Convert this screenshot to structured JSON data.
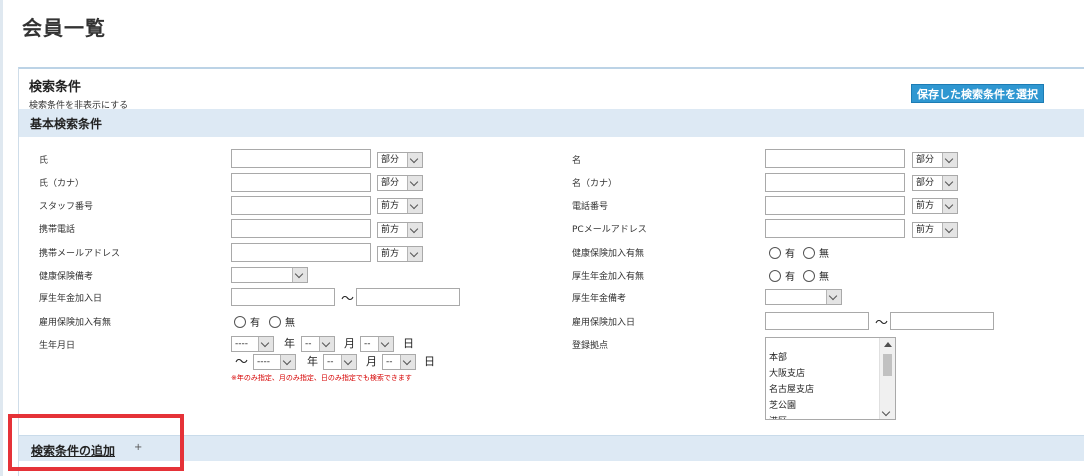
{
  "page": {
    "title": "会員一覧"
  },
  "panel": {
    "title": "検索条件",
    "hide_link": "検索条件を非表示にする",
    "saved_button": "保存した検索条件を選択",
    "basic_section": "基本検索条件",
    "add_link": "検索条件の追加",
    "add_icon": "+"
  },
  "fields": {
    "sei": {
      "label": "氏",
      "match": "部分"
    },
    "sei_kana": {
      "label": "氏（カナ）",
      "match": "部分"
    },
    "staff_no": {
      "label": "スタッフ番号",
      "match": "前方"
    },
    "mobile": {
      "label": "携帯電話",
      "match": "前方"
    },
    "mobile_mail": {
      "label": "携帯メールアドレス",
      "match": "前方"
    },
    "health_note": {
      "label": "健康保険備考"
    },
    "pension_date": {
      "label": "厚生年金加入日",
      "tilde": "〜"
    },
    "employment_ins": {
      "label": "雇用保険加入有無",
      "yes": "有",
      "no": "無"
    },
    "birthday": {
      "label": "生年月日",
      "year_placeholder": "----",
      "month_placeholder": "--",
      "day_placeholder": "--",
      "year_unit": "年",
      "month_unit": "月",
      "day_unit": "日",
      "tilde": "〜",
      "note": "※年のみ指定、月のみ指定、日のみ指定でも検索できます"
    },
    "mei": {
      "label": "名",
      "match": "部分"
    },
    "mei_kana": {
      "label": "名（カナ）",
      "match": "部分"
    },
    "phone": {
      "label": "電話番号",
      "match": "前方"
    },
    "pc_mail": {
      "label": "PCメールアドレス",
      "match": "前方"
    },
    "health_ins": {
      "label": "健康保険加入有無",
      "yes": "有",
      "no": "無"
    },
    "pension_ins": {
      "label": "厚生年金加入有無",
      "yes": "有",
      "no": "無"
    },
    "pension_note": {
      "label": "厚生年金備考"
    },
    "employment_date": {
      "label": "雇用保険加入日",
      "tilde": "〜"
    },
    "base": {
      "label": "登録拠点",
      "options": [
        "本部",
        "大阪支店",
        "名古屋支店",
        "芝公園",
        "港区"
      ]
    }
  }
}
